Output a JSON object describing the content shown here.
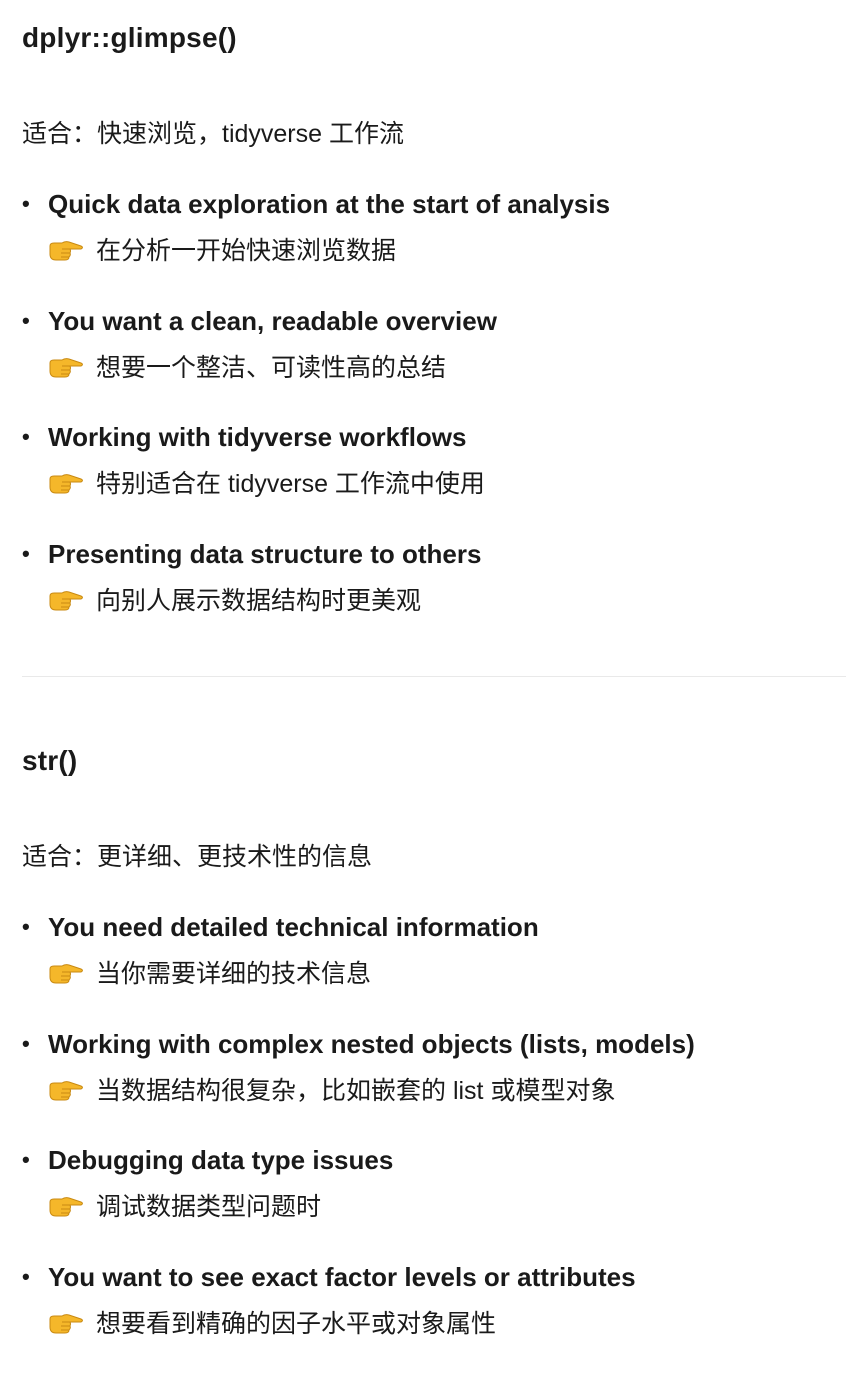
{
  "sections": [
    {
      "title": "dplyr::glimpse()",
      "suitable": "适合：快速浏览，tidyverse 工作流",
      "items": [
        {
          "en": "Quick data exploration at the start of analysis",
          "zh": "在分析一开始快速浏览数据"
        },
        {
          "en": "You want a clean, readable overview",
          "zh": "想要一个整洁、可读性高的总结"
        },
        {
          "en": "Working with tidyverse workflows",
          "zh": "特别适合在 tidyverse 工作流中使用"
        },
        {
          "en": "Presenting data structure to others",
          "zh": "向别人展示数据结构时更美观"
        }
      ]
    },
    {
      "title": "str()",
      "suitable": "适合：更详细、更技术性的信息",
      "items": [
        {
          "en": "You need detailed technical information",
          "zh": "当你需要详细的技术信息"
        },
        {
          "en": "Working with complex nested objects (lists, models)",
          "zh": "当数据结构很复杂，比如嵌套的 list 或模型对象"
        },
        {
          "en": "Debugging data type issues",
          "zh": "调试数据类型问题时"
        },
        {
          "en": "You want to see exact factor levels or attributes",
          "zh": "想要看到精确的因子水平或对象属性"
        }
      ]
    }
  ],
  "bullet_char": "•",
  "pointer_icon": "backhand-index-pointing-right-icon"
}
